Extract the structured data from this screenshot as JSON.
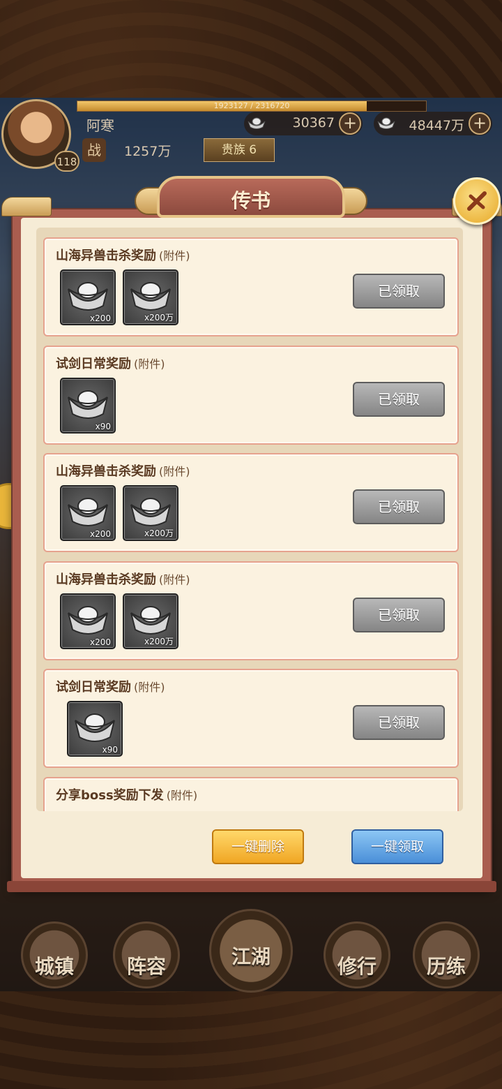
{
  "hud": {
    "player_name": "阿寒",
    "level": "118",
    "exp_text": "1923127 / 2316720",
    "exp_fraction": 0.83,
    "currency_1": "30367",
    "currency_2": "48447万",
    "power_icon_text": "战",
    "power_value": "1257万",
    "noble_text": "贵族 6"
  },
  "dialog": {
    "title": "传书",
    "mails": [
      {
        "title": "山海异兽击杀奖励",
        "tag": "(附件)",
        "items": [
          {
            "icon": "silver-ingot",
            "qty": "x200"
          },
          {
            "icon": "silver-ingot",
            "qty": "x200万"
          }
        ],
        "status": "已领取"
      },
      {
        "title": "试剑日常奖励",
        "tag": "(附件)",
        "items": [
          {
            "icon": "silver-ingot",
            "qty": "x90"
          }
        ],
        "status": "已领取"
      },
      {
        "title": "山海异兽击杀奖励",
        "tag": "(附件)",
        "items": [
          {
            "icon": "silver-ingot",
            "qty": "x200"
          },
          {
            "icon": "silver-ingot",
            "qty": "x200万"
          }
        ],
        "status": "已领取"
      },
      {
        "title": "山海异兽击杀奖励",
        "tag": "(附件)",
        "items": [
          {
            "icon": "silver-ingot",
            "qty": "x200"
          },
          {
            "icon": "silver-ingot",
            "qty": "x200万"
          }
        ],
        "status": "已领取"
      },
      {
        "title": "试剑日常奖励",
        "tag": "(附件)",
        "items": [
          {
            "icon": "silver-ingot",
            "qty": "x90"
          }
        ],
        "status": "已领取"
      },
      {
        "title": "分享boss奖励下发",
        "tag": "(附件)",
        "items": [],
        "status": ""
      }
    ],
    "delete_all": "一键删除",
    "claim_all": "一键领取"
  },
  "nav": {
    "items": [
      "城镇",
      "阵容",
      "江湖",
      "修行",
      "历练"
    ]
  },
  "colors": {
    "dialog_frame": "#a95d4f",
    "parchment": "#f6ecd6",
    "claimed_gray": "#9a9a9a",
    "delete_gold": "#f0a624",
    "claim_blue": "#4a8fd8"
  }
}
